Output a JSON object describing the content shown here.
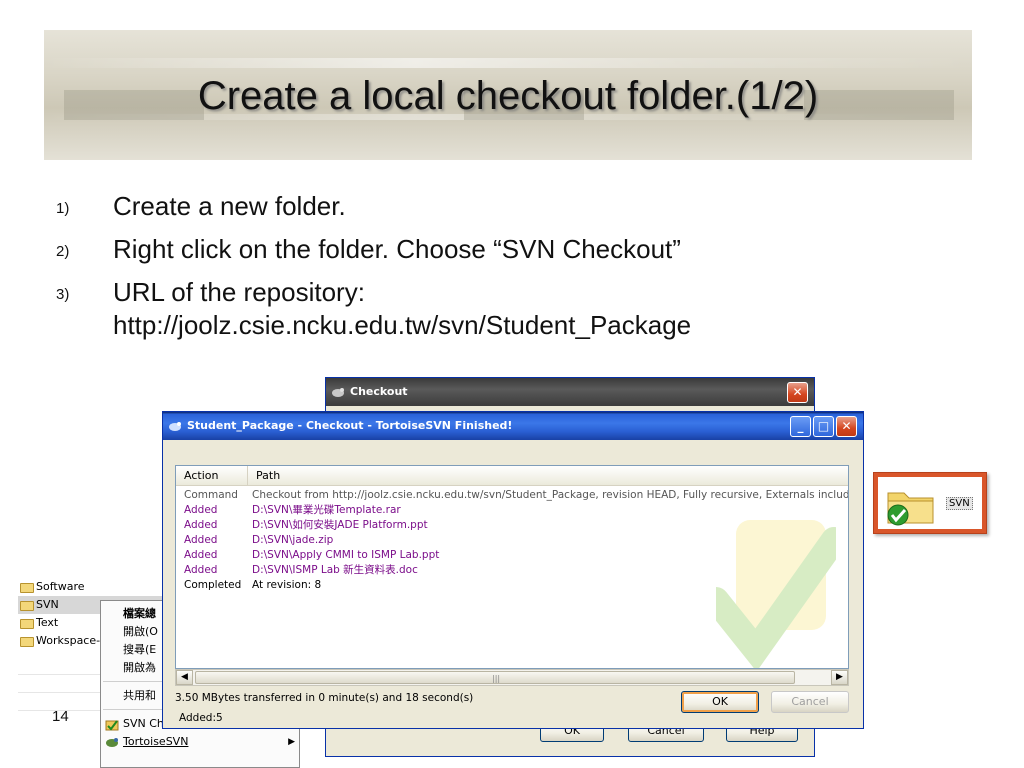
{
  "slide": {
    "title": "Create a local checkout folder.(1/2)",
    "page_number": "14"
  },
  "bullets": [
    {
      "num": "1)",
      "text": "Create a new folder."
    },
    {
      "num": "2)",
      "text": "Right click on the folder. Choose “SVN Checkout”"
    },
    {
      "num": "3)",
      "text": "URL of the repository:",
      "url": "http://joolz.csie.ncku.edu.tw/svn/Student_Package"
    }
  ],
  "explorer": {
    "folders": [
      "Software",
      "SVN",
      "Text",
      "Workspace-"
    ]
  },
  "context_menu": {
    "items": [
      "檔案總",
      "開啟(O",
      "搜尋(E",
      "開啟為",
      "共用和",
      "SVN Ch",
      "TortoiseSVN"
    ]
  },
  "checkout_dialog": {
    "title": "Checkout",
    "buttons": {
      "ok": "OK",
      "cancel": "Cancel",
      "help": "Help"
    }
  },
  "progress_dialog": {
    "title": "Student_Package - Checkout - TortoiseSVN Finished!",
    "columns": [
      "Action",
      "Path"
    ],
    "rows": [
      {
        "action": "Command",
        "path": "Checkout from http://joolz.csie.ncku.edu.tw/svn/Student_Package, revision HEAD, Fully recursive, Externals include",
        "kind": "cmd"
      },
      {
        "action": "Added",
        "path": "D:\\SVN\\畢業光碟Template.rar",
        "kind": "add"
      },
      {
        "action": "Added",
        "path": "D:\\SVN\\如何安裝JADE Platform.ppt",
        "kind": "add"
      },
      {
        "action": "Added",
        "path": "D:\\SVN\\jade.zip",
        "kind": "add"
      },
      {
        "action": "Added",
        "path": "D:\\SVN\\Apply CMMI to ISMP Lab.ppt",
        "kind": "add"
      },
      {
        "action": "Added",
        "path": "D:\\SVN\\ISMP Lab 新生資料表.doc",
        "kind": "add"
      },
      {
        "action": "Completed",
        "path": "At revision: 8",
        "kind": "done"
      }
    ],
    "transfer_text": "3.50 MBytes transferred in 0 minute(s) and 18 second(s)",
    "summary_text": "Added:5",
    "ok_label": "OK",
    "cancel_label": "Cancel"
  },
  "svn_icon": {
    "label": "SVN"
  },
  "colors": {
    "added_text": "#7b0d8a",
    "xp_titlebar": "#2a5fd3",
    "accent_box": "#d9562a"
  }
}
